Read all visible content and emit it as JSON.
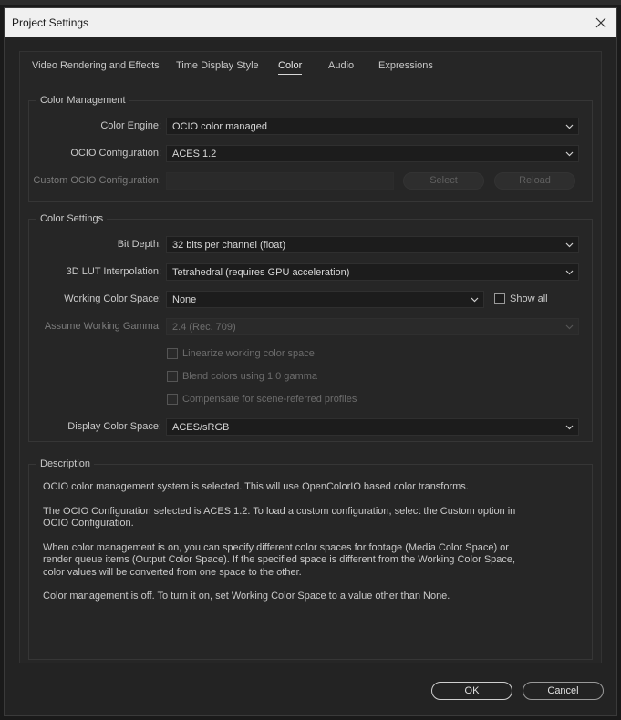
{
  "window": {
    "title": "Project Settings"
  },
  "tabs": [
    {
      "label": "Video Rendering and Effects"
    },
    {
      "label": "Time Display Style"
    },
    {
      "label": "Color"
    },
    {
      "label": "Audio"
    },
    {
      "label": "Expressions"
    }
  ],
  "active_tab": "Color",
  "color_management": {
    "title": "Color Management",
    "engine_label": "Color Engine:",
    "engine_value": "OCIO color managed",
    "ocio_config_label": "OCIO Configuration:",
    "ocio_config_value": "ACES 1.2",
    "custom_ocio_label": "Custom OCIO Configuration:",
    "custom_ocio_value": "",
    "select_label": "Select",
    "reload_label": "Reload"
  },
  "color_settings": {
    "title": "Color Settings",
    "bit_depth_label": "Bit Depth:",
    "bit_depth_value": "32 bits per channel (float)",
    "lut_label": "3D LUT Interpolation:",
    "lut_value": "Tetrahedral (requires GPU acceleration)",
    "working_space_label": "Working Color Space:",
    "working_space_value": "None",
    "show_all_label": "Show all",
    "show_all_checked": false,
    "gamma_label": "Assume Working Gamma:",
    "gamma_value": "2.4 (Rec. 709)",
    "linearize_label": "Linearize working color space",
    "blend_label": "Blend colors using 1.0 gamma",
    "compensate_label": "Compensate for scene-referred profiles",
    "display_space_label": "Display Color Space:",
    "display_space_value": "ACES/sRGB"
  },
  "description": {
    "title": "Description",
    "paragraphs": [
      "OCIO color management system is selected. This will use OpenColorIO based color transforms.",
      "The OCIO Configuration selected is ACES 1.2. To load a custom configuration, select the Custom option in OCIO Configuration.",
      "When color management is on, you can specify different color spaces for footage (Media Color Space) or render queue items (Output Color Space). If the specified space is different from the Working Color Space, color values will be converted from one space to the other.",
      "Color management is off. To turn it on, set Working Color Space to a value other than None."
    ]
  },
  "footer": {
    "ok_label": "OK",
    "cancel_label": "Cancel"
  },
  "colors": {
    "title_bar": "#f0f0f0",
    "dialog_bg": "#232323",
    "panel_bg": "#262626"
  },
  "icons": {
    "close": "close-icon",
    "dropdown": "chevron-down-icon"
  }
}
